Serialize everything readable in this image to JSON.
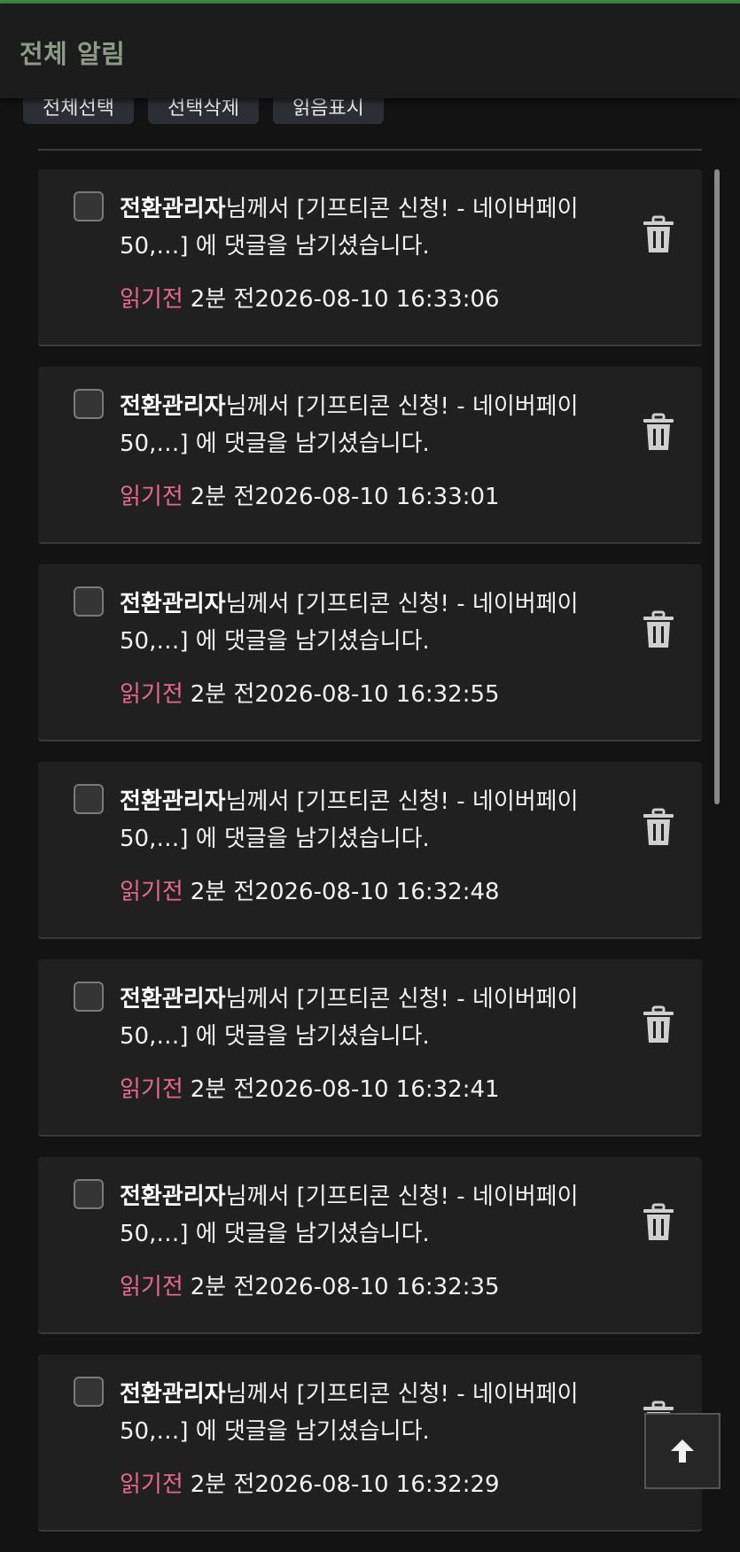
{
  "header": {
    "title": "전체 알림"
  },
  "toolbar": {
    "select_all": "전체선택",
    "delete_selected": "선택삭제",
    "mark_read": "읽음표시"
  },
  "notifications": [
    {
      "sender": "전환관리자",
      "text": "님께서 [기프티콘 신청! - 네이버페이 50,…] 에 댓글을 남기셨습니다.",
      "status": "읽기전",
      "relative": "2분 전",
      "timestamp": "2026-08-10 16:33:06"
    },
    {
      "sender": "전환관리자",
      "text": "님께서 [기프티콘 신청! - 네이버페이 50,…] 에 댓글을 남기셨습니다.",
      "status": "읽기전",
      "relative": "2분 전",
      "timestamp": "2026-08-10 16:33:01"
    },
    {
      "sender": "전환관리자",
      "text": "님께서 [기프티콘 신청! - 네이버페이 50,…] 에 댓글을 남기셨습니다.",
      "status": "읽기전",
      "relative": "2분 전",
      "timestamp": "2026-08-10 16:32:55"
    },
    {
      "sender": "전환관리자",
      "text": "님께서 [기프티콘 신청! - 네이버페이 50,…] 에 댓글을 남기셨습니다.",
      "status": "읽기전",
      "relative": "2분 전",
      "timestamp": "2026-08-10 16:32:48"
    },
    {
      "sender": "전환관리자",
      "text": "님께서 [기프티콘 신청! - 네이버페이 50,…] 에 댓글을 남기셨습니다.",
      "status": "읽기전",
      "relative": "2분 전",
      "timestamp": "2026-08-10 16:32:41"
    },
    {
      "sender": "전환관리자",
      "text": "님께서 [기프티콘 신청! - 네이버페이 50,…] 에 댓글을 남기셨습니다.",
      "status": "읽기전",
      "relative": "2분 전",
      "timestamp": "2026-08-10 16:32:35"
    },
    {
      "sender": "전환관리자",
      "text": "님께서 [기프티콘 신청! - 네이버페이 50,…] 에 댓글을 남기셨습니다.",
      "status": "읽기전",
      "relative": "2분 전",
      "timestamp": "2026-08-10 16:32:29"
    }
  ],
  "colors": {
    "accent": "#3a8a3c",
    "unread": "#e8688c",
    "title": "#8c9b88"
  },
  "icons": {
    "delete": "trash-icon",
    "scroll_top": "arrow-up-icon"
  }
}
